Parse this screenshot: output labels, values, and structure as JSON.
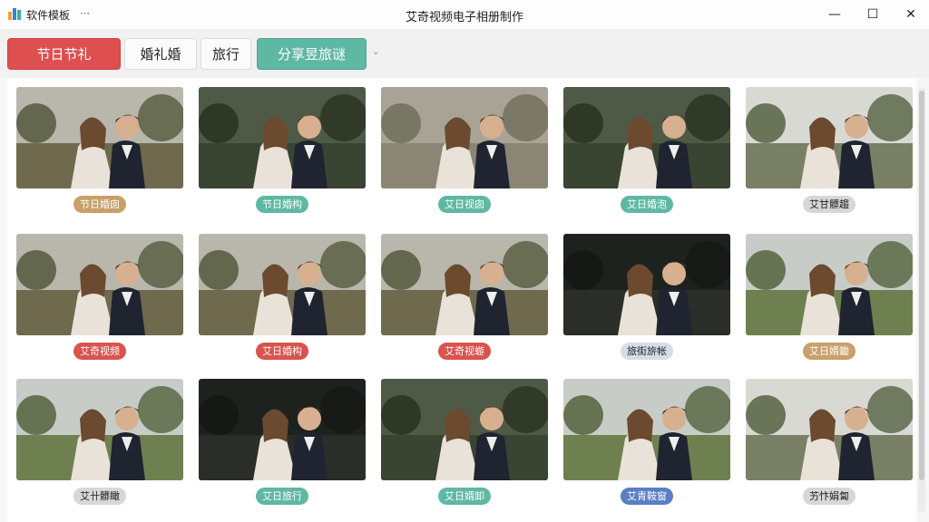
{
  "app": {
    "name": "软件模板",
    "menu_glyph": "⋯",
    "window_title": "艾奇视频电子相册制作"
  },
  "window_controls": {
    "minimize": "—",
    "maximize": "☐",
    "close": "✕"
  },
  "tabs": [
    {
      "label": "节日节礼",
      "style": "active"
    },
    {
      "label": "婚礼婚",
      "style": "plain"
    },
    {
      "label": "旅行",
      "style": "plain"
    },
    {
      "label": "分享昱旅谜",
      "style": "share"
    }
  ],
  "dropdown_glyph": "⌄",
  "colors": {
    "red": "#d9534f",
    "teal": "#5fb8a3",
    "tan": "#c7a06a",
    "gray": "#d7d7d7",
    "blue": "#5b7fc4",
    "lightblue": "#d5dde8"
  },
  "templates": [
    {
      "tag": "节日婚囱",
      "tag_color": "tan",
      "scene": "garden"
    },
    {
      "tag": "节日婚构",
      "tag_color": "teal",
      "scene": "forest"
    },
    {
      "tag": "艾日视囱",
      "tag_color": "teal",
      "scene": "bouquet"
    },
    {
      "tag": "艾日婚泡",
      "tag_color": "teal",
      "scene": "forest"
    },
    {
      "tag": "艾甘髒趨",
      "tag_color": "gray",
      "scene": "manor"
    },
    {
      "tag": "艾奇视频",
      "tag_color": "red",
      "scene": "garden"
    },
    {
      "tag": "艾日婚构",
      "tag_color": "red",
      "scene": "garden"
    },
    {
      "tag": "艾奇视蝣",
      "tag_color": "red",
      "scene": "garden"
    },
    {
      "tag": "旅街旂帐",
      "tag_color": "lightblue",
      "scene": "night"
    },
    {
      "tag": "艾日婿鋤",
      "tag_color": "tan",
      "scene": "meadow"
    },
    {
      "tag": "艾卄髒瞰",
      "tag_color": "gray",
      "scene": "meadow"
    },
    {
      "tag": "艾日旅行",
      "tag_color": "teal",
      "scene": "night"
    },
    {
      "tag": "艾日婿卸",
      "tag_color": "teal",
      "scene": "forest"
    },
    {
      "tag": "艾青鞍窗",
      "tag_color": "blue",
      "scene": "meadow"
    },
    {
      "tag": "艻忭娟匐",
      "tag_color": "gray",
      "scene": "manor"
    }
  ]
}
